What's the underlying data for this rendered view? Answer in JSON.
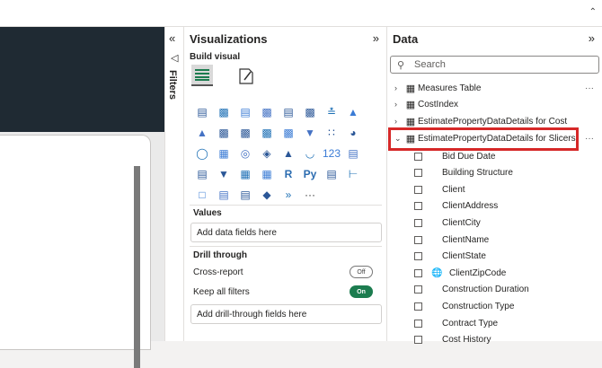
{
  "colors": {
    "accent": "#d62828",
    "toggle_on": "#1c7c4f",
    "dark_band": "#1f2a33"
  },
  "filters": {
    "label": "Filters",
    "collapse_icon": "double-chevron-left-icon",
    "filter_icon": "funnel-icon"
  },
  "visualizations": {
    "title": "Visualizations",
    "build_visual": "Build visual",
    "icons": [
      "stacked-bar-chart",
      "stacked-column-chart",
      "clustered-bar-chart",
      "clustered-column-chart",
      "100-stacked-bar-chart",
      "100-stacked-column-chart",
      "line-chart",
      "area-chart",
      "stacked-area-chart",
      "line-and-column-chart",
      "line-and-clustered-column-chart",
      "ribbon-chart",
      "waterfall-chart",
      "funnel-chart",
      "scatter-chart",
      "pie-chart",
      "donut-chart",
      "treemap",
      "map",
      "filled-map",
      "azure-map",
      "gauge",
      "card",
      "multi-row-card",
      "kpi",
      "slicer",
      "table",
      "matrix",
      "r-script-visual",
      "python-visual",
      "key-influencers",
      "decomposition-tree",
      "qa-visual",
      "smart-narrative",
      "paginated-report",
      "power-apps",
      "power-automate",
      "more-visuals"
    ],
    "values_label": "Values",
    "values_placeholder": "Add data fields here",
    "drill_through_label": "Drill through",
    "cross_report_label": "Cross-report",
    "cross_report_state": "Off",
    "keep_filters_label": "Keep all filters",
    "keep_filters_state": "On",
    "drill_placeholder": "Add drill-through fields here"
  },
  "data": {
    "title": "Data",
    "search_placeholder": "Search",
    "tables": [
      {
        "name": "Measures Table",
        "expanded": false
      },
      {
        "name": "CostIndex",
        "expanded": false
      },
      {
        "name": "EstimatePropertyDataDetails for Cost",
        "expanded": false
      },
      {
        "name": "EstimatePropertyDataDetails for Slicers",
        "expanded": true
      }
    ],
    "fields": [
      "Bid Due Date",
      "Building Structure",
      "Client",
      "ClientAddress",
      "ClientCity",
      "ClientName",
      "ClientState",
      "ClientZipCode",
      "Construction Duration",
      "Construction Type",
      "Contract Type",
      "Cost History"
    ]
  }
}
